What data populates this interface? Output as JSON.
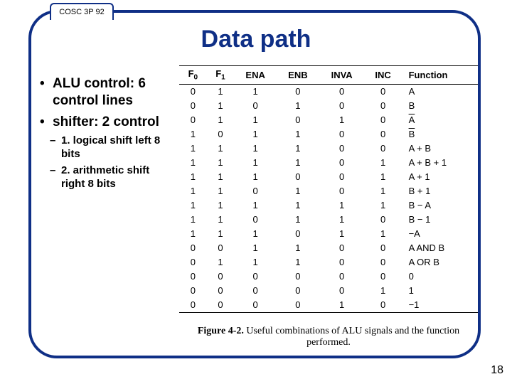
{
  "course_code": "COSC 3P 92",
  "title": "Data path",
  "bullets": {
    "b1": "ALU control: 6 control lines",
    "b2": "shifter: 2 control",
    "s1": "1. logical shift left 8 bits",
    "s2": "2. arithmetic shift right 8 bits"
  },
  "table": {
    "headers": {
      "f0": "F",
      "f0_sub": "0",
      "f1": "F",
      "f1_sub": "1",
      "ena": "ENA",
      "enb": "ENB",
      "inva": "INVA",
      "inc": "INC",
      "fn": "Function"
    }
  },
  "caption": {
    "label": "Figure 4-2.",
    "text": " Useful combinations of ALU signals and the function performed."
  },
  "page_number": "18",
  "chart_data": {
    "type": "table",
    "columns": [
      "F0",
      "F1",
      "ENA",
      "ENB",
      "INVA",
      "INC",
      "Function"
    ],
    "rows": [
      {
        "F0": 0,
        "F1": 1,
        "ENA": 1,
        "ENB": 0,
        "INVA": 0,
        "INC": 0,
        "Function": "A"
      },
      {
        "F0": 0,
        "F1": 1,
        "ENA": 0,
        "ENB": 1,
        "INVA": 0,
        "INC": 0,
        "Function": "B"
      },
      {
        "F0": 0,
        "F1": 1,
        "ENA": 1,
        "ENB": 0,
        "INVA": 1,
        "INC": 0,
        "Function": "A¯",
        "overline": "A"
      },
      {
        "F0": 1,
        "F1": 0,
        "ENA": 1,
        "ENB": 1,
        "INVA": 0,
        "INC": 0,
        "Function": "B¯",
        "overline": "B"
      },
      {
        "F0": 1,
        "F1": 1,
        "ENA": 1,
        "ENB": 1,
        "INVA": 0,
        "INC": 0,
        "Function": "A + B"
      },
      {
        "F0": 1,
        "F1": 1,
        "ENA": 1,
        "ENB": 1,
        "INVA": 0,
        "INC": 1,
        "Function": "A + B + 1"
      },
      {
        "F0": 1,
        "F1": 1,
        "ENA": 1,
        "ENB": 0,
        "INVA": 0,
        "INC": 1,
        "Function": "A + 1"
      },
      {
        "F0": 1,
        "F1": 1,
        "ENA": 0,
        "ENB": 1,
        "INVA": 0,
        "INC": 1,
        "Function": "B + 1"
      },
      {
        "F0": 1,
        "F1": 1,
        "ENA": 1,
        "ENB": 1,
        "INVA": 1,
        "INC": 1,
        "Function": "B − A"
      },
      {
        "F0": 1,
        "F1": 1,
        "ENA": 0,
        "ENB": 1,
        "INVA": 1,
        "INC": 0,
        "Function": "B − 1"
      },
      {
        "F0": 1,
        "F1": 1,
        "ENA": 1,
        "ENB": 0,
        "INVA": 1,
        "INC": 1,
        "Function": "−A"
      },
      {
        "F0": 0,
        "F1": 0,
        "ENA": 1,
        "ENB": 1,
        "INVA": 0,
        "INC": 0,
        "Function": "A AND B"
      },
      {
        "F0": 0,
        "F1": 1,
        "ENA": 1,
        "ENB": 1,
        "INVA": 0,
        "INC": 0,
        "Function": "A OR B"
      },
      {
        "F0": 0,
        "F1": 0,
        "ENA": 0,
        "ENB": 0,
        "INVA": 0,
        "INC": 0,
        "Function": "0"
      },
      {
        "F0": 0,
        "F1": 0,
        "ENA": 0,
        "ENB": 0,
        "INVA": 0,
        "INC": 1,
        "Function": "1"
      },
      {
        "F0": 0,
        "F1": 0,
        "ENA": 0,
        "ENB": 0,
        "INVA": 1,
        "INC": 0,
        "Function": "−1"
      }
    ]
  }
}
